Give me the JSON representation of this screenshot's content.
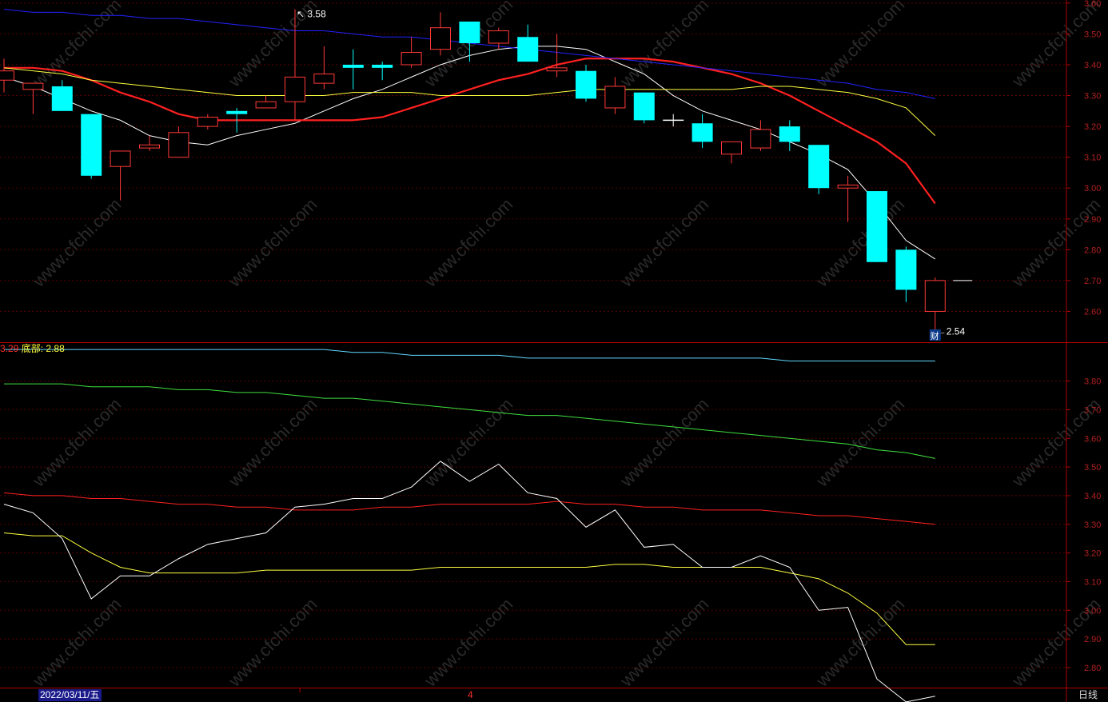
{
  "chart_data": [
    {
      "type": "candlestick",
      "panel": "main",
      "ylim": [
        2.5,
        3.61
      ],
      "y_ticks": [
        "3.60",
        "3.50",
        "3.40",
        "3.30",
        "3.20",
        "3.10",
        "3.00",
        "2.90",
        "2.80",
        "2.70",
        "2.60"
      ],
      "colors": {
        "up": "#ff3838",
        "down": "#00ffff",
        "flat": "#ffffff"
      },
      "candles": [
        {
          "o": 3.35,
          "h": 3.42,
          "l": 3.31,
          "c": 3.38
        },
        {
          "o": 3.32,
          "h": 3.34,
          "l": 3.24,
          "c": 3.34
        },
        {
          "o": 3.33,
          "h": 3.35,
          "l": 3.25,
          "c": 3.25
        },
        {
          "o": 3.24,
          "h": 3.24,
          "l": 3.03,
          "c": 3.04
        },
        {
          "o": 3.07,
          "h": 3.12,
          "l": 2.96,
          "c": 3.12
        },
        {
          "o": 3.13,
          "h": 3.17,
          "l": 3.12,
          "c": 3.14
        },
        {
          "o": 3.1,
          "h": 3.2,
          "l": 3.1,
          "c": 3.18
        },
        {
          "o": 3.2,
          "h": 3.24,
          "l": 3.19,
          "c": 3.23
        },
        {
          "o": 3.25,
          "h": 3.26,
          "l": 3.18,
          "c": 3.24
        },
        {
          "o": 3.26,
          "h": 3.3,
          "l": 3.26,
          "c": 3.28
        },
        {
          "o": 3.28,
          "h": 3.58,
          "l": 3.22,
          "c": 3.36
        },
        {
          "o": 3.34,
          "h": 3.46,
          "l": 3.32,
          "c": 3.37
        },
        {
          "o": 3.4,
          "h": 3.45,
          "l": 3.32,
          "c": 3.39
        },
        {
          "o": 3.4,
          "h": 3.41,
          "l": 3.35,
          "c": 3.39
        },
        {
          "o": 3.4,
          "h": 3.49,
          "l": 3.39,
          "c": 3.44
        },
        {
          "o": 3.45,
          "h": 3.57,
          "l": 3.43,
          "c": 3.52
        },
        {
          "o": 3.54,
          "h": 3.54,
          "l": 3.41,
          "c": 3.47
        },
        {
          "o": 3.47,
          "h": 3.52,
          "l": 3.45,
          "c": 3.51
        },
        {
          "o": 3.49,
          "h": 3.53,
          "l": 3.41,
          "c": 3.41
        },
        {
          "o": 3.38,
          "h": 3.5,
          "l": 3.36,
          "c": 3.39
        },
        {
          "o": 3.38,
          "h": 3.4,
          "l": 3.28,
          "c": 3.29
        },
        {
          "o": 3.26,
          "h": 3.36,
          "l": 3.24,
          "c": 3.33
        },
        {
          "o": 3.31,
          "h": 3.31,
          "l": 3.21,
          "c": 3.22
        },
        {
          "o": 3.22,
          "h": 3.24,
          "l": 3.2,
          "c": 3.22
        },
        {
          "o": 3.21,
          "h": 3.24,
          "l": 3.13,
          "c": 3.15
        },
        {
          "o": 3.11,
          "h": 3.15,
          "l": 3.08,
          "c": 3.15
        },
        {
          "o": 3.13,
          "h": 3.22,
          "l": 3.12,
          "c": 3.19
        },
        {
          "o": 3.2,
          "h": 3.22,
          "l": 3.12,
          "c": 3.15
        },
        {
          "o": 3.14,
          "h": 3.14,
          "l": 2.98,
          "c": 3.0
        },
        {
          "o": 3.0,
          "h": 3.04,
          "l": 2.89,
          "c": 3.01
        },
        {
          "o": 2.99,
          "h": 2.99,
          "l": 2.76,
          "c": 2.76
        },
        {
          "o": 2.8,
          "h": 2.81,
          "l": 2.63,
          "c": 2.67
        },
        {
          "o": 2.6,
          "h": 2.71,
          "l": 2.54,
          "c": 2.7
        }
      ],
      "ma": [
        {
          "color": "#ffffff",
          "values": [
            3.36,
            3.33,
            3.29,
            3.25,
            3.22,
            3.17,
            3.15,
            3.14,
            3.17,
            3.19,
            3.21,
            3.25,
            3.29,
            3.32,
            3.36,
            3.4,
            3.43,
            3.45,
            3.46,
            3.46,
            3.45,
            3.41,
            3.37,
            3.3,
            3.25,
            3.22,
            3.19,
            3.15,
            3.11,
            3.06,
            2.95,
            2.83,
            2.77
          ]
        },
        {
          "color": "#ff2020",
          "values": [
            3.39,
            3.39,
            3.38,
            3.35,
            3.31,
            3.28,
            3.24,
            3.22,
            3.22,
            3.22,
            3.22,
            3.22,
            3.22,
            3.23,
            3.26,
            3.29,
            3.32,
            3.35,
            3.37,
            3.4,
            3.42,
            3.42,
            3.42,
            3.41,
            3.39,
            3.37,
            3.34,
            3.3,
            3.25,
            3.2,
            3.15,
            3.08,
            2.95
          ]
        },
        {
          "color": "#ffff40",
          "values": [
            3.39,
            3.38,
            3.37,
            3.35,
            3.34,
            3.33,
            3.32,
            3.31,
            3.3,
            3.3,
            3.3,
            3.3,
            3.31,
            3.31,
            3.31,
            3.3,
            3.3,
            3.3,
            3.3,
            3.31,
            3.32,
            3.32,
            3.32,
            3.32,
            3.32,
            3.32,
            3.33,
            3.33,
            3.32,
            3.31,
            3.29,
            3.26,
            3.17
          ]
        },
        {
          "color": "#2222ff",
          "values": [
            3.58,
            3.57,
            3.57,
            3.56,
            3.56,
            3.55,
            3.55,
            3.54,
            3.53,
            3.52,
            3.51,
            3.51,
            3.5,
            3.49,
            3.49,
            3.48,
            3.47,
            3.46,
            3.45,
            3.44,
            3.43,
            3.42,
            3.41,
            3.4,
            3.39,
            3.38,
            3.37,
            3.36,
            3.35,
            3.34,
            3.32,
            3.31,
            3.29
          ]
        }
      ],
      "annotations": {
        "high_label": "3.58",
        "low_label": "2.54",
        "low_marker": "←",
        "high_marker": "↖",
        "event_label": "财",
        "last_close_label": "2.70"
      }
    },
    {
      "type": "line",
      "panel": "indicator",
      "ylim": [
        2.73,
        3.93
      ],
      "y_ticks": [
        "3.80",
        "3.70",
        "3.60",
        "3.50",
        "3.40",
        "3.30",
        "3.20",
        "3.10",
        "3.00",
        "2.90",
        "2.80"
      ],
      "legend": {
        "top_value": "3.29",
        "bottom_label": "底部:",
        "bottom_value": "2.88"
      },
      "series": [
        {
          "color": "#5fd7ff",
          "values": [
            3.91,
            3.91,
            3.91,
            3.91,
            3.91,
            3.91,
            3.91,
            3.91,
            3.91,
            3.91,
            3.91,
            3.91,
            3.9,
            3.9,
            3.89,
            3.89,
            3.89,
            3.89,
            3.88,
            3.88,
            3.88,
            3.88,
            3.88,
            3.88,
            3.88,
            3.88,
            3.88,
            3.87,
            3.87,
            3.87,
            3.87,
            3.87,
            3.87
          ]
        },
        {
          "color": "#40e040",
          "values": [
            3.79,
            3.79,
            3.79,
            3.78,
            3.78,
            3.78,
            3.77,
            3.77,
            3.76,
            3.76,
            3.75,
            3.74,
            3.74,
            3.73,
            3.72,
            3.71,
            3.7,
            3.69,
            3.68,
            3.68,
            3.67,
            3.66,
            3.65,
            3.64,
            3.63,
            3.62,
            3.61,
            3.6,
            3.59,
            3.58,
            3.56,
            3.55,
            3.53
          ]
        },
        {
          "color": "#ff2020",
          "values": [
            3.41,
            3.4,
            3.4,
            3.39,
            3.39,
            3.38,
            3.37,
            3.37,
            3.36,
            3.36,
            3.35,
            3.35,
            3.35,
            3.36,
            3.36,
            3.37,
            3.37,
            3.37,
            3.37,
            3.38,
            3.37,
            3.37,
            3.36,
            3.36,
            3.35,
            3.35,
            3.35,
            3.34,
            3.33,
            3.33,
            3.32,
            3.31,
            3.3
          ]
        },
        {
          "color": "#ffff40",
          "values": [
            3.27,
            3.26,
            3.26,
            3.2,
            3.15,
            3.13,
            3.13,
            3.13,
            3.13,
            3.14,
            3.14,
            3.14,
            3.14,
            3.14,
            3.14,
            3.15,
            3.15,
            3.15,
            3.15,
            3.15,
            3.15,
            3.16,
            3.16,
            3.15,
            3.15,
            3.15,
            3.15,
            3.13,
            3.11,
            3.06,
            2.99,
            2.88,
            2.88
          ]
        },
        {
          "color": "#ffffff",
          "values": [
            3.37,
            3.34,
            3.25,
            3.04,
            3.12,
            3.12,
            3.18,
            3.23,
            3.25,
            3.27,
            3.36,
            3.37,
            3.39,
            3.39,
            3.43,
            3.52,
            3.45,
            3.51,
            3.41,
            3.39,
            3.29,
            3.35,
            3.22,
            3.23,
            3.15,
            3.15,
            3.19,
            3.15,
            3.0,
            3.01,
            2.76,
            2.68,
            2.7
          ]
        }
      ]
    }
  ],
  "footer": {
    "date_label": "2022/03/11/五",
    "month_tick": "4",
    "period_label": "日线"
  },
  "watermark": "www.cfchi.com"
}
